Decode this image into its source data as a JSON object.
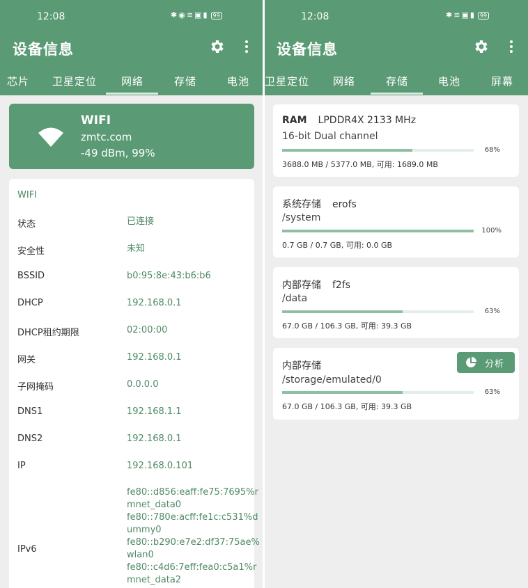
{
  "left": {
    "status_time": "12:08",
    "app_title": "设备信息",
    "battery": "99",
    "tabs": [
      "芯片",
      "卫星定位",
      "网络",
      "存储",
      "电池"
    ],
    "active_tab": "网络",
    "wifi_card": {
      "title": "WIFI",
      "ssid": "zmtc.com",
      "signal": "-49 dBm, 99%"
    },
    "info": {
      "heading": "WIFI",
      "rows": [
        {
          "label": "状态",
          "value": "已连接"
        },
        {
          "label": "安全性",
          "value": "未知"
        },
        {
          "label": "BSSID",
          "value": "b0:95:8e:43:b6:b6"
        },
        {
          "label": "DHCP",
          "value": "192.168.0.1"
        },
        {
          "label": "DHCP租约期限",
          "value": "02:00:00"
        },
        {
          "label": "网关",
          "value": "192.168.0.1"
        },
        {
          "label": "子网掩码",
          "value": "0.0.0.0"
        },
        {
          "label": "DNS1",
          "value": "192.168.1.1"
        },
        {
          "label": "DNS2",
          "value": "192.168.0.1"
        },
        {
          "label": "IP",
          "value": "192.168.0.101"
        }
      ],
      "ipv6_label": "IPv6",
      "ipv6_lines": [
        "fe80::d856:eaff:fe75:7695%r",
        "mnet_data0",
        "fe80::780e:acff:fe1c:c531%d",
        "ummy0",
        "fe80::b290:e7e2:df37:75ae%",
        "wlan0",
        "fe80::c4d6:7eff:fea0:c5a1%r",
        "mnet_data2"
      ]
    }
  },
  "right": {
    "status_time": "12:08",
    "app_title": "设备信息",
    "battery": "99",
    "tabs": [
      "卫星定位",
      "网络",
      "存储",
      "电池",
      "屏幕"
    ],
    "active_tab": "存储",
    "storage": [
      {
        "name": "RAM",
        "type": "LPDDR4X 2133 MHz",
        "sub": "16-bit Dual channel",
        "percent": 68,
        "percent_label": "68%",
        "detail": "3688.0 MB / 5377.0 MB, 可用: 1689.0 MB"
      },
      {
        "name": "系统存储",
        "type": "erofs",
        "sub": "/system",
        "percent": 100,
        "percent_label": "100%",
        "detail": "0.7 GB / 0.7 GB, 可用: 0.0 GB"
      },
      {
        "name": "内部存储",
        "type": "f2fs",
        "sub": "/data",
        "percent": 63,
        "percent_label": "63%",
        "detail": "67.0 GB / 106.3 GB, 可用: 39.3 GB"
      },
      {
        "name": "内部存储",
        "type": "",
        "sub": "/storage/emulated/0",
        "percent": 63,
        "percent_label": "63%",
        "detail": "67.0 GB / 106.3 GB, 可用: 39.3 GB"
      }
    ],
    "analyze_label": "分析"
  },
  "colors": {
    "primary": "#5a9a74",
    "accent_text": "#4e8a66",
    "bar_fill": "#8cc0a0",
    "bar_track": "#e3eee8",
    "background": "#eeeeee"
  },
  "icons": [
    "bluetooth-icon",
    "location-icon",
    "wifi-icon",
    "hd-icon",
    "signal-icon",
    "battery-icon",
    "gear-icon",
    "more-vert-icon",
    "wifi-signal-icon",
    "pie-chart-icon"
  ]
}
